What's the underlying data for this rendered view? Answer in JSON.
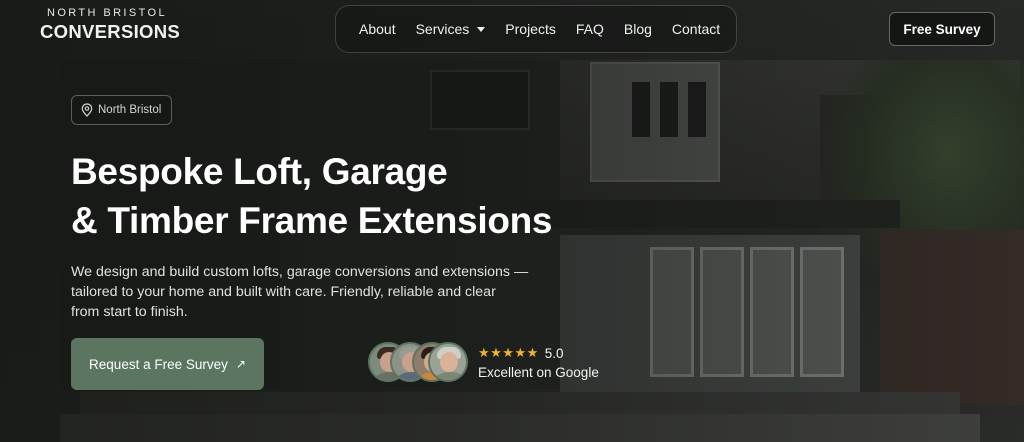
{
  "brand": {
    "top": "NORTH BRISTOL",
    "main": "CONVERSIONS"
  },
  "nav": {
    "items": [
      {
        "label": "About"
      },
      {
        "label": "Services"
      },
      {
        "label": "Projects"
      },
      {
        "label": "FAQ"
      },
      {
        "label": "Blog"
      },
      {
        "label": "Contact"
      }
    ]
  },
  "header": {
    "cta_label": "Free Survey"
  },
  "hero": {
    "location": "North Bristol",
    "title_line1": "Bespoke Loft, Garage",
    "title_line2": "& Timber Frame Extensions",
    "description_line1": "We design and build custom lofts, garage conversions and extensions —",
    "description_line2": "tailored to your home and built with care. Friendly, reliable and clear",
    "description_line3": "from start to finish.",
    "cta_label": "Request a Free Survey",
    "cta_arrow": "↗"
  },
  "reviews": {
    "stars": "★★★★★",
    "score": "5.0",
    "source": "Excellent on Google"
  },
  "colors": {
    "accent": "#5c7561",
    "star": "#f0b429"
  },
  "icons": {
    "location": "map-pin-icon",
    "nav_caret": "chevron-down-icon",
    "cta": "arrow-up-right-icon"
  }
}
